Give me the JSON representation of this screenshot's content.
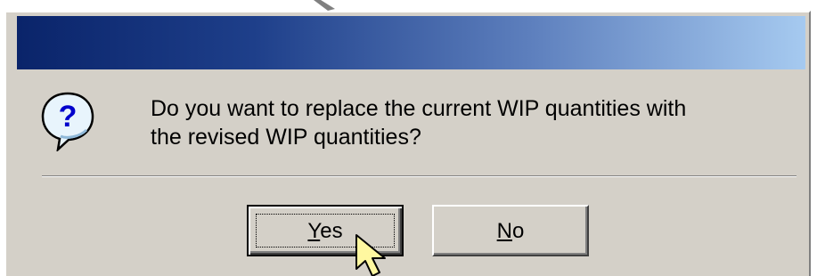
{
  "dialog": {
    "title": "",
    "message_line1": "Do you want to replace the current WIP quantities with",
    "message_line2": "the revised WIP quantities?",
    "icon": "question-icon"
  },
  "buttons": {
    "yes": {
      "mnemonic": "Y",
      "rest": "es"
    },
    "no": {
      "mnemonic": "N",
      "rest": "o"
    }
  },
  "colors": {
    "dialog_face": "#d4d0c8",
    "title_gradient_start": "#0a246a",
    "title_gradient_end": "#a6caf0",
    "icon_bubble": "#e8f4fc",
    "icon_glyph": "#0000cc"
  }
}
